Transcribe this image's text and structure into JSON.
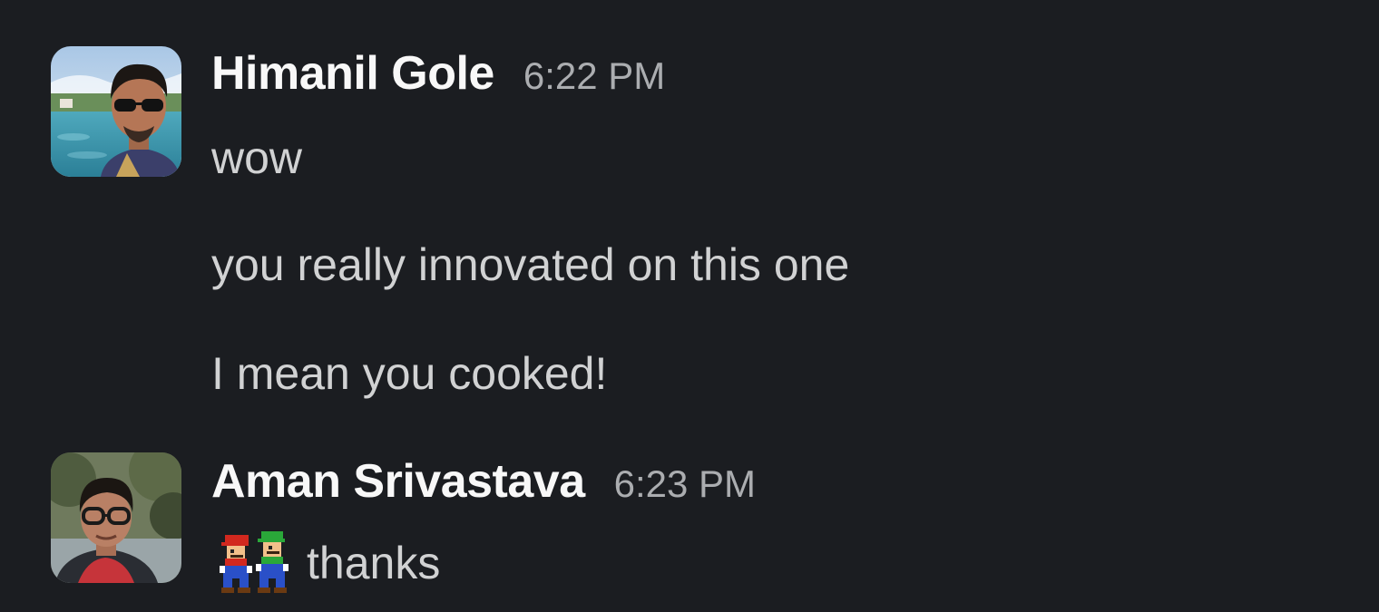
{
  "messages": [
    {
      "author": "Himanil Gole",
      "time": "6:22 PM",
      "avatar": "profile-photo-sunglasses",
      "lines": [
        "wow",
        "you really innovated on this one",
        "I mean you cooked!"
      ]
    },
    {
      "author": "Aman Srivastava",
      "time": "6:23 PM",
      "avatar": "profile-photo-glasses",
      "emoji": "mario-luigi-emoji",
      "lines": [
        "thanks"
      ]
    }
  ],
  "colors": {
    "background": "#1b1d21",
    "author": "#f8f8f8",
    "timestamp": "#abadb0",
    "text": "#d1d2d3"
  }
}
